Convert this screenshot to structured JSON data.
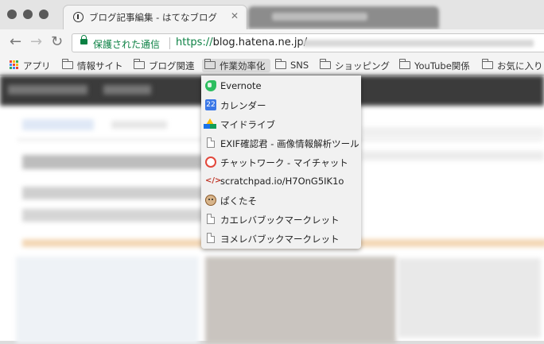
{
  "window": {
    "tab_title": "ブログ記事編集 - はてなブログ",
    "tab_close": "✕"
  },
  "toolbar": {
    "back_glyph": "←",
    "forward_glyph": "→",
    "reload_glyph": "↻",
    "secure_label": "保護された通信",
    "url_scheme": "https://",
    "url_host": "blog.hatena.ne.jp",
    "url_rest": "/"
  },
  "bookmarks": [
    {
      "label": "アプリ",
      "icon": "apps-grid-icon"
    },
    {
      "label": "情報サイト",
      "icon": "folder-icon"
    },
    {
      "label": "ブログ関連",
      "icon": "folder-icon"
    },
    {
      "label": "作業効率化",
      "icon": "folder-icon",
      "active": true
    },
    {
      "label": "SNS",
      "icon": "folder-icon"
    },
    {
      "label": "ショッピング",
      "icon": "folder-icon"
    },
    {
      "label": "YouTube関係",
      "icon": "folder-icon"
    },
    {
      "label": "お気に入り",
      "icon": "folder-icon"
    }
  ],
  "dropdown": {
    "items": [
      {
        "label": "Evernote",
        "icon": "evernote-icon"
      },
      {
        "label": "カレンダー",
        "icon": "calendar-icon",
        "icon_text": "22"
      },
      {
        "label": "マイドライブ",
        "icon": "google-drive-icon"
      },
      {
        "label": "EXIF確認君 - 画像情報解析ツール",
        "icon": "page-icon"
      },
      {
        "label": "チャットワーク - マイチャット",
        "icon": "chatwork-icon"
      },
      {
        "label": "scratchpad.io/H7OnG5IK1o",
        "icon": "code-icon",
        "icon_text": "</>"
      },
      {
        "label": "ぱくたそ",
        "icon": "pakutaso-icon"
      },
      {
        "label": "カエレバブックマークレット",
        "icon": "page-icon"
      },
      {
        "label": "ヨメレバブックマークレット",
        "icon": "page-icon"
      }
    ]
  },
  "colors": {
    "secure_green": "#0b8043",
    "evernote_green": "#2dbe60",
    "calendar_blue": "#3b78e7",
    "chatwork_red": "#e2473b"
  }
}
